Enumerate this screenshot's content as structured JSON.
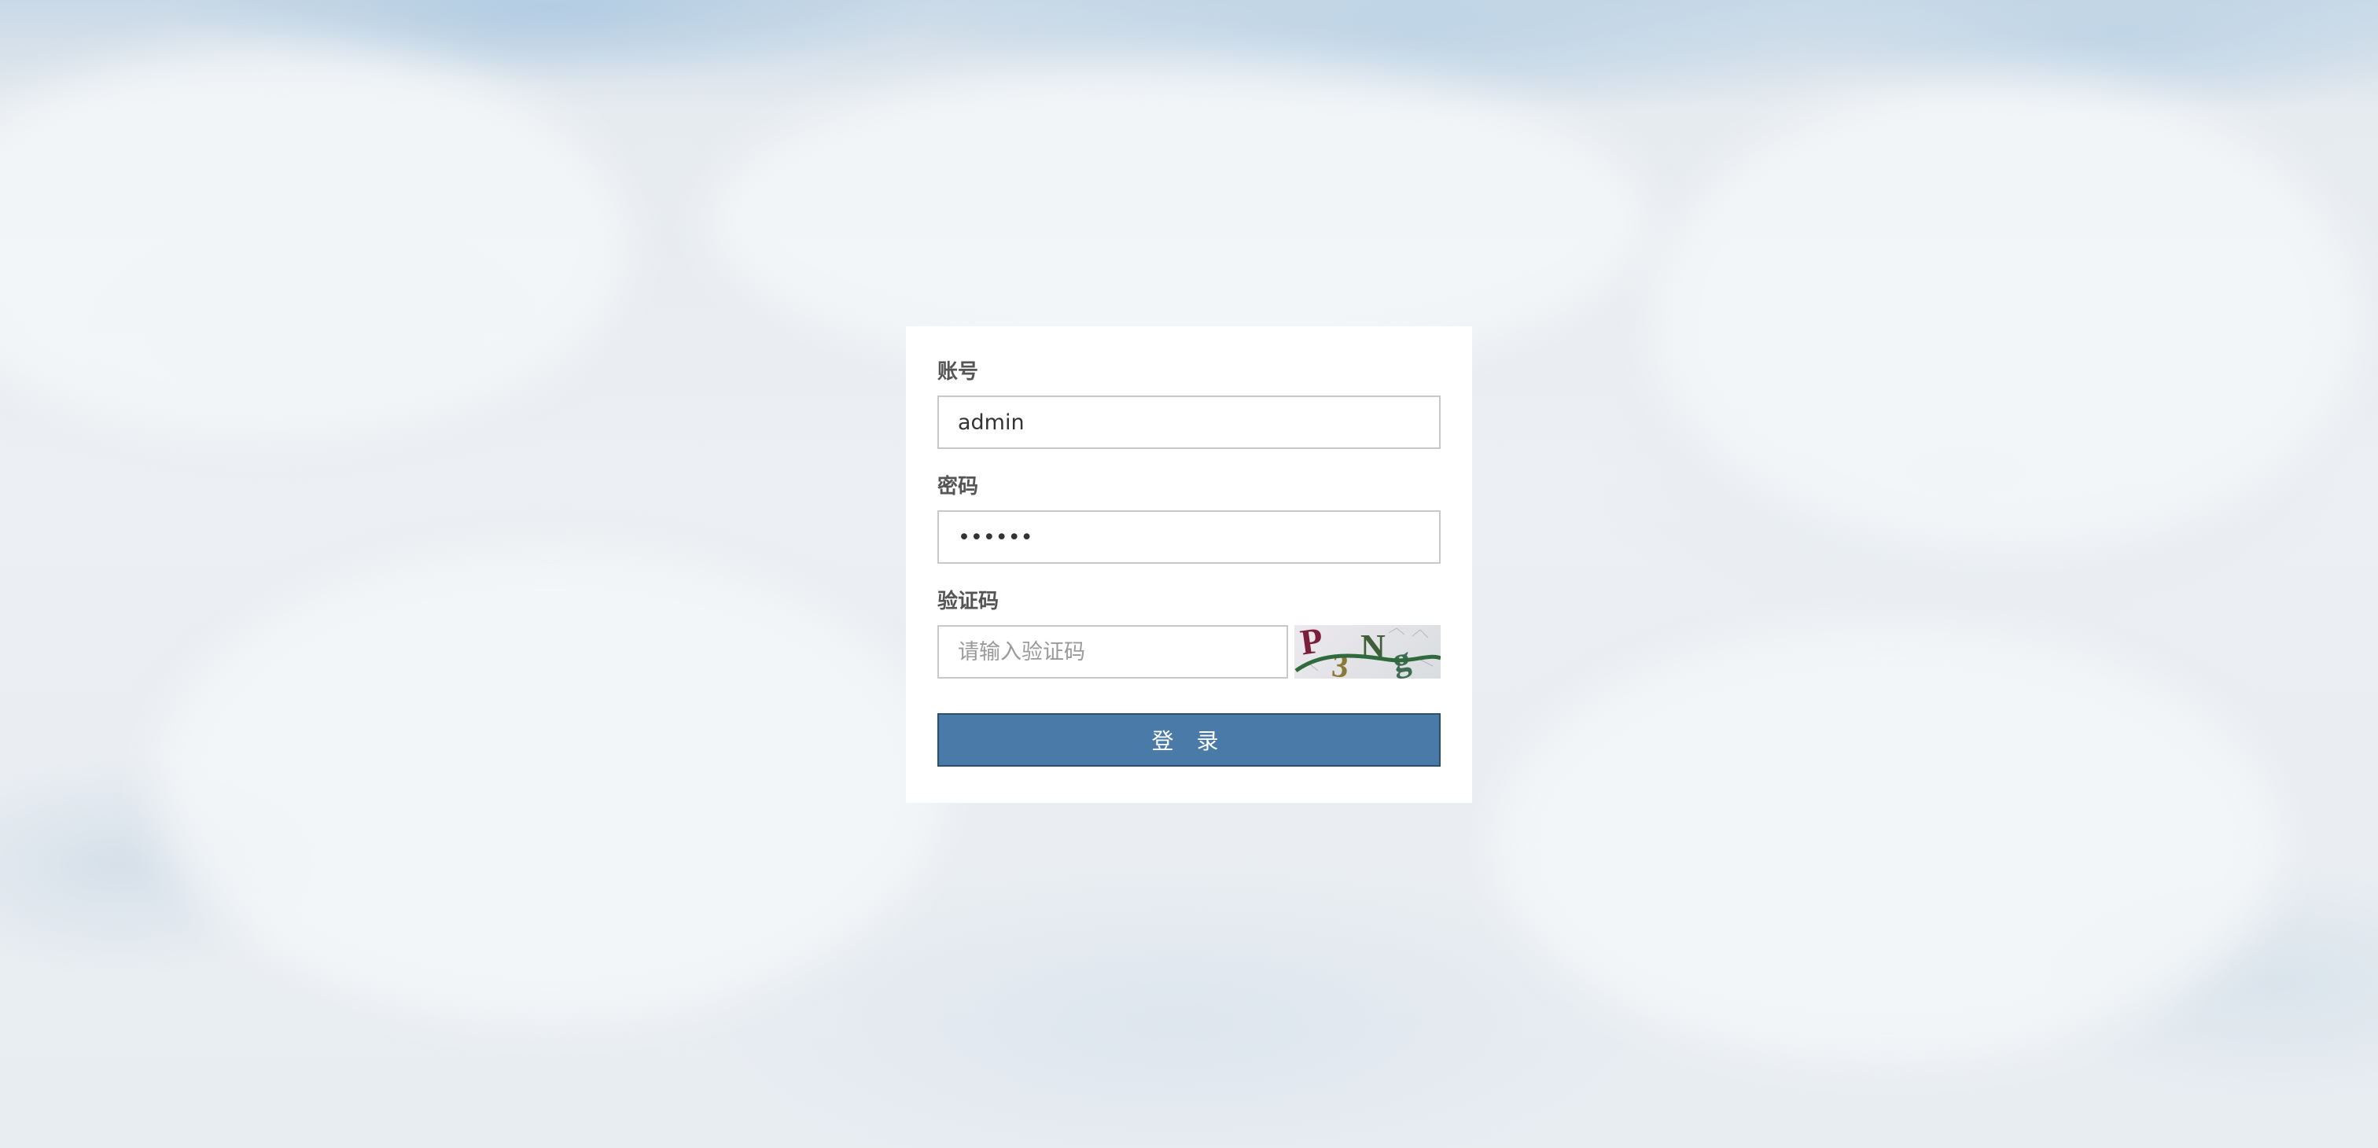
{
  "form": {
    "account_label": "账号",
    "account_value": "admin",
    "password_label": "密码",
    "password_value": "123456",
    "captcha_label": "验证码",
    "captcha_placeholder": "请输入验证码",
    "captcha_text": "P3Ng",
    "submit_label": "登 录"
  },
  "colors": {
    "button_bg": "#4a7ba8",
    "button_border": "#2d4f6e",
    "label": "#555555",
    "card_bg": "#ffffff"
  },
  "background": "cloudy-sky-image"
}
